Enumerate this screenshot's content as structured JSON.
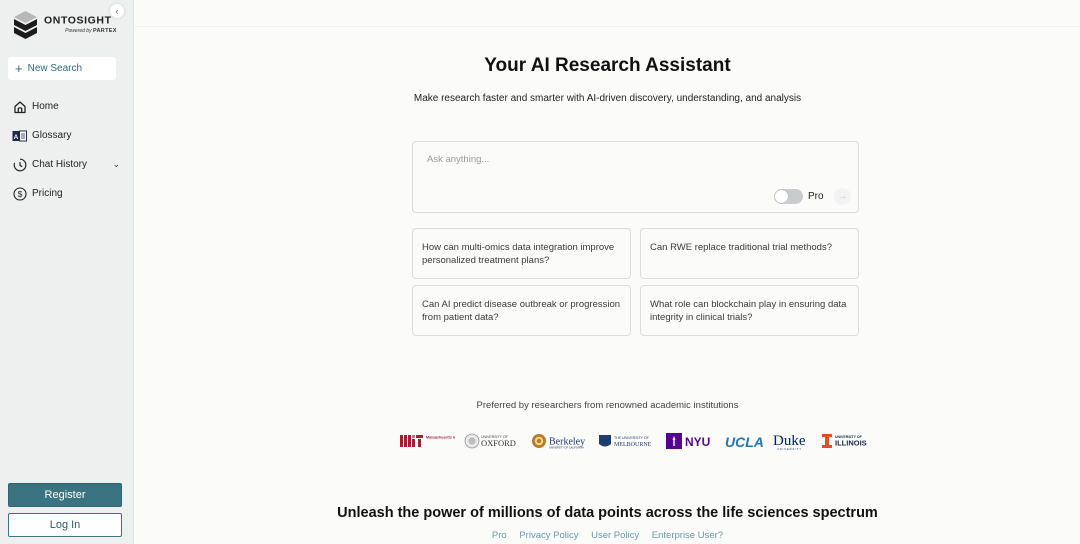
{
  "brand": {
    "name": "ONTOSIGHT",
    "registered": "®",
    "powered_by": "Powered by",
    "partner": "PARTEX",
    "accent_color": "#3a7480"
  },
  "sidebar": {
    "collapse_icon": "chevron-left-icon",
    "new_search_label": "New Search",
    "items": [
      {
        "label": "Home",
        "icon": "home-icon"
      },
      {
        "label": "Glossary",
        "icon": "glossary-icon"
      },
      {
        "label": "Chat History",
        "icon": "clock-icon",
        "expandable": true
      },
      {
        "label": "Pricing",
        "icon": "dollar-icon"
      }
    ],
    "register_label": "Register",
    "login_label": "Log In"
  },
  "main": {
    "title": "Your AI Research Assistant",
    "subtitle": "Make research faster and smarter with AI-driven discovery, understanding, and analysis",
    "ask": {
      "placeholder": "Ask anything...",
      "value": "",
      "pro_label": "Pro",
      "pro_enabled": false
    },
    "suggestions": [
      "How can multi-omics data integration improve personalized treatment plans?",
      "Can RWE replace traditional trial methods?",
      "Can AI predict disease outbreak or progression from patient data?",
      "What role can blockchain play in ensuring data integrity in clinical trials?"
    ],
    "preferred_text": "Preferred by researchers from renowned academic institutions",
    "institutions": [
      {
        "name": "MIT",
        "sub": "Massachusetts Institute of Technology"
      },
      {
        "name": "OXFORD",
        "sub": "UNIVERSITY OF"
      },
      {
        "name": "Berkeley",
        "sub": "UNIVERSITY OF CALIFORNIA"
      },
      {
        "name": "MELBOURNE",
        "sub": "THE UNIVERSITY OF"
      },
      {
        "name": "NYU"
      },
      {
        "name": "UCLA"
      },
      {
        "name": "Duke",
        "sub": "UNIVERSITY"
      },
      {
        "name": "ILLINOIS",
        "sub": "UNIVERSITY OF"
      }
    ],
    "tagline": "Unleash the power of millions of data points across the life sciences spectrum",
    "footer_links": [
      "Pro",
      "Privacy Policy",
      "User Policy",
      "Enterprise User?"
    ]
  }
}
